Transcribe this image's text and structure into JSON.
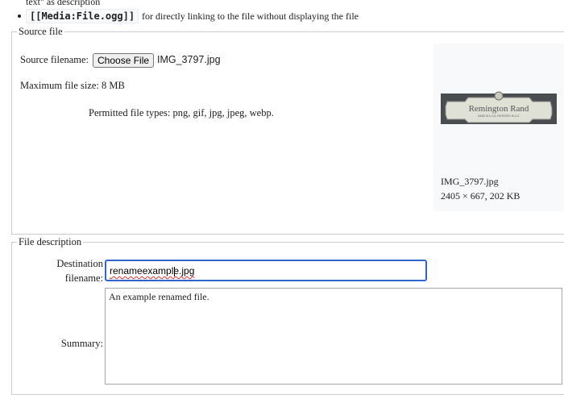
{
  "intro": {
    "trailing_text": "text\" as description",
    "bullet_code": "[[Media:File.ogg]]",
    "bullet_text": "for directly linking to the file without displaying the file"
  },
  "source_file": {
    "legend": "Source file",
    "filename_label": "Source filename:",
    "choose_button": "Choose File",
    "chosen_filename": "IMG_3797.jpg",
    "max_size_text": "Maximum file size: 8 MB",
    "permitted_text": "Permitted file types: png, gif, jpg, jpeg, webp.",
    "preview": {
      "plaque_text": "Remington Rand",
      "plaque_subtext": "MADE IN U.S.A. PATENTED IN U.S.",
      "filename": "IMG_3797.jpg",
      "info": "2405 × 667, 202 KB"
    }
  },
  "file_description": {
    "legend": "File description",
    "destination_label_line1": "Destination",
    "destination_label_line2": "filename:",
    "destination_value": "renameexample.jpg",
    "summary_label": "Summary:",
    "summary_value": "An example renamed file."
  },
  "colors": {
    "focus_border": "#3366cc",
    "fieldset_border": "#c8ccd1",
    "preview_bg": "#f8f9fa",
    "spell_error": "#dd3333"
  }
}
